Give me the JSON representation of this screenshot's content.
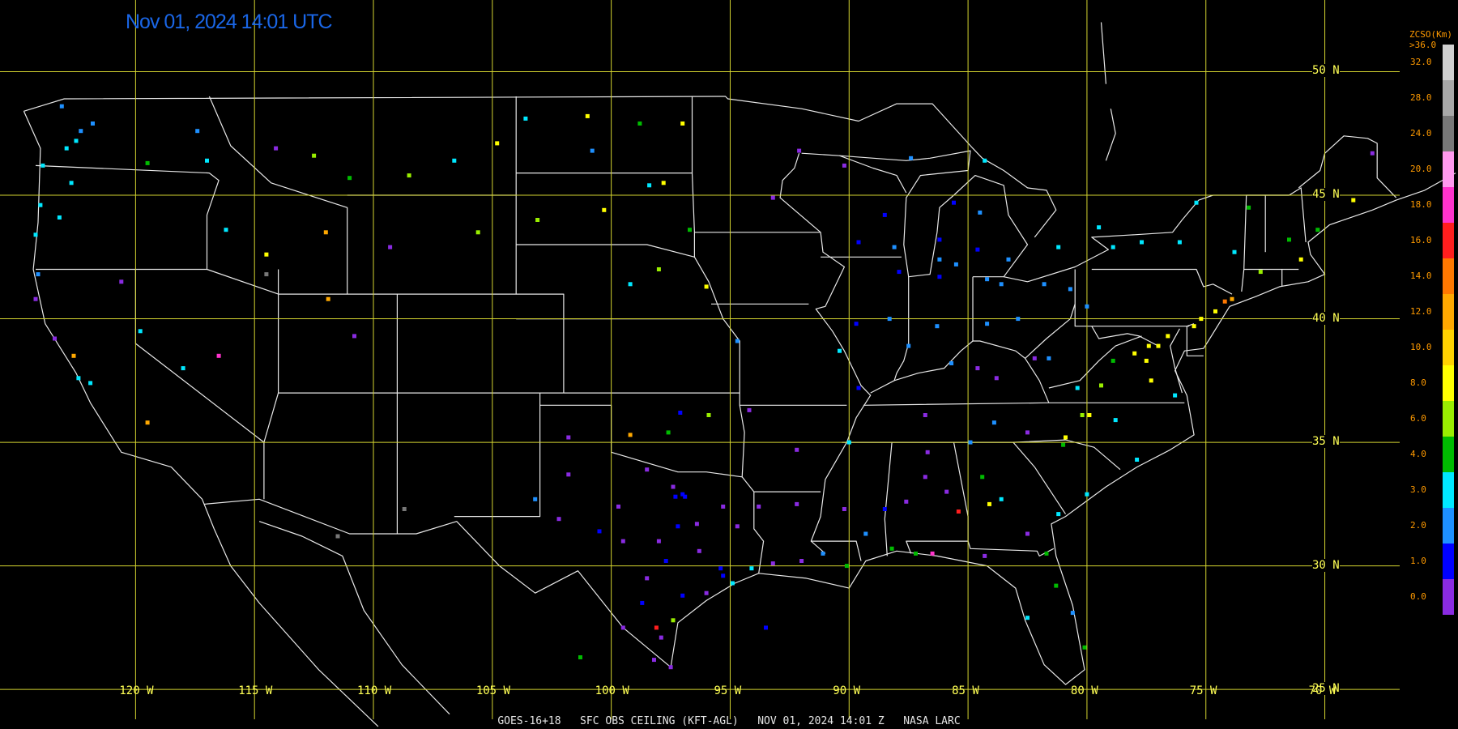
{
  "header": {
    "timestamp": "Nov 01, 2024 14:01 UTC",
    "timestamp_color": "#1a66e6"
  },
  "footer": {
    "caption": "GOES-16+18   SFC OBS CEILING (KFT-AGL)   NOV 01, 2024 14:01 Z   NASA LARC"
  },
  "grid": {
    "color": "#d4d430",
    "latitudes": [
      {
        "value": 50,
        "label": "50 N"
      },
      {
        "value": 45,
        "label": "45 N"
      },
      {
        "value": 40,
        "label": "40 N"
      },
      {
        "value": 35,
        "label": "35 N"
      },
      {
        "value": 30,
        "label": "30 N"
      },
      {
        "value": 25,
        "label": "25 N"
      }
    ],
    "longitudes": [
      {
        "value": -120,
        "label": "120 W"
      },
      {
        "value": -115,
        "label": "115 W"
      },
      {
        "value": -110,
        "label": "110 W"
      },
      {
        "value": -105,
        "label": "105 W"
      },
      {
        "value": -100,
        "label": "100 W"
      },
      {
        "value": -95,
        "label": "95 W"
      },
      {
        "value": -90,
        "label": "90 W"
      },
      {
        "value": -85,
        "label": "85 W"
      },
      {
        "value": -80,
        "label": "80 W"
      },
      {
        "value": -75,
        "label": "75 W"
      },
      {
        "value": -70,
        "label": "70 W"
      }
    ]
  },
  "map_extent": {
    "lon_min": -125.7,
    "lon_max": -64.4,
    "lat_min": 23.4,
    "lat_max": 52.9
  },
  "colors": {
    "background": "#000000",
    "boundaries": "#e8e8e8",
    "legend_text": "#ff9a00"
  },
  "legend": {
    "title": "ZCSO(Km)",
    "top_label": ">36.0",
    "classes": [
      {
        "label": "32.0",
        "color": "#d0d0d0"
      },
      {
        "label": "28.0",
        "color": "#a8a8a8"
      },
      {
        "label": "24.0",
        "color": "#787878"
      },
      {
        "label": "20.0",
        "color": "#ff99ee"
      },
      {
        "label": "18.0",
        "color": "#ff33cc"
      },
      {
        "label": "16.0",
        "color": "#ff1e1e"
      },
      {
        "label": "14.0",
        "color": "#ff7800"
      },
      {
        "label": "12.0",
        "color": "#ffa800"
      },
      {
        "label": "10.0",
        "color": "#ffd200"
      },
      {
        "label": "8.0",
        "color": "#ffff00"
      },
      {
        "label": "6.0",
        "color": "#99ee00"
      },
      {
        "label": "4.0",
        "color": "#00bb00"
      },
      {
        "label": "3.0",
        "color": "#00e8ff"
      },
      {
        "label": "2.0",
        "color": "#1e90ff"
      },
      {
        "label": "1.0",
        "color": "#0000ff"
      },
      {
        "label": "0.0",
        "color": "#8a2be2"
      }
    ]
  },
  "observations": [
    {
      "lon": -123.1,
      "lat": 48.6,
      "v": 2.5
    },
    {
      "lon": -122.3,
      "lat": 47.6,
      "v": 2.5
    },
    {
      "lon": -122.5,
      "lat": 47.2,
      "v": 3.5
    },
    {
      "lon": -121.8,
      "lat": 47.9,
      "v": 2.5
    },
    {
      "lon": -122.9,
      "lat": 46.9,
      "v": 3.5
    },
    {
      "lon": -123.9,
      "lat": 46.2,
      "v": 3.5
    },
    {
      "lon": -124.0,
      "lat": 44.6,
      "v": 3.5
    },
    {
      "lon": -123.2,
      "lat": 44.1,
      "v": 3.5
    },
    {
      "lon": -122.7,
      "lat": 45.5,
      "v": 3.5
    },
    {
      "lon": -124.2,
      "lat": 43.4,
      "v": 3.5
    },
    {
      "lon": -124.1,
      "lat": 41.8,
      "v": 2.5
    },
    {
      "lon": -124.2,
      "lat": 40.8,
      "v": 0.5
    },
    {
      "lon": -123.4,
      "lat": 39.2,
      "v": 0.5
    },
    {
      "lon": -122.4,
      "lat": 37.6,
      "v": 3.5
    },
    {
      "lon": -121.9,
      "lat": 37.4,
      "v": 3.5
    },
    {
      "lon": -122.6,
      "lat": 38.5,
      "v": 13
    },
    {
      "lon": -117.4,
      "lat": 47.6,
      "v": 2.5
    },
    {
      "lon": -119.5,
      "lat": 46.3,
      "v": 4.5
    },
    {
      "lon": -117.0,
      "lat": 46.4,
      "v": 3.5
    },
    {
      "lon": -116.2,
      "lat": 43.6,
      "v": 3.5
    },
    {
      "lon": -114.5,
      "lat": 42.6,
      "v": 9
    },
    {
      "lon": -112.0,
      "lat": 43.5,
      "v": 13
    },
    {
      "lon": -111.0,
      "lat": 45.7,
      "v": 5
    },
    {
      "lon": -112.5,
      "lat": 46.6,
      "v": 7
    },
    {
      "lon": -114.1,
      "lat": 46.9,
      "v": 0.5
    },
    {
      "lon": -108.5,
      "lat": 45.8,
      "v": 7
    },
    {
      "lon": -106.6,
      "lat": 46.4,
      "v": 3.5
    },
    {
      "lon": -104.8,
      "lat": 47.1,
      "v": 9
    },
    {
      "lon": -109.3,
      "lat": 42.9,
      "v": 0.5
    },
    {
      "lon": -105.6,
      "lat": 43.5,
      "v": 7
    },
    {
      "lon": -111.9,
      "lat": 40.8,
      "v": 13
    },
    {
      "lon": -110.8,
      "lat": 39.3,
      "v": 0.5
    },
    {
      "lon": -119.8,
      "lat": 39.5,
      "v": 3.5
    },
    {
      "lon": -120.6,
      "lat": 41.5,
      "v": 0.5
    },
    {
      "lon": -118.0,
      "lat": 38.0,
      "v": 3.5
    },
    {
      "lon": -119.5,
      "lat": 35.8,
      "v": 13
    },
    {
      "lon": -116.5,
      "lat": 38.5,
      "v": 19
    },
    {
      "lon": -101.0,
      "lat": 48.2,
      "v": 9
    },
    {
      "lon": -98.8,
      "lat": 47.9,
      "v": 5
    },
    {
      "lon": -97.0,
      "lat": 47.9,
      "v": 9
    },
    {
      "lon": -100.8,
      "lat": 46.8,
      "v": 2.5
    },
    {
      "lon": -103.6,
      "lat": 48.1,
      "v": 3.5
    },
    {
      "lon": -97.8,
      "lat": 45.5,
      "v": 9
    },
    {
      "lon": -96.7,
      "lat": 43.6,
      "v": 5
    },
    {
      "lon": -98.4,
      "lat": 45.4,
      "v": 3.5
    },
    {
      "lon": -100.3,
      "lat": 44.4,
      "v": 9
    },
    {
      "lon": -103.1,
      "lat": 44.0,
      "v": 7
    },
    {
      "lon": -96.0,
      "lat": 41.3,
      "v": 9
    },
    {
      "lon": -98.0,
      "lat": 42.0,
      "v": 7
    },
    {
      "lon": -99.2,
      "lat": 41.4,
      "v": 3.5
    },
    {
      "lon": -93.2,
      "lat": 44.9,
      "v": 0.5
    },
    {
      "lon": -92.1,
      "lat": 46.8,
      "v": 0.5
    },
    {
      "lon": -90.2,
      "lat": 46.2,
      "v": 0.5
    },
    {
      "lon": -89.6,
      "lat": 43.1,
      "v": 1.5
    },
    {
      "lon": -88.1,
      "lat": 42.9,
      "v": 2.5
    },
    {
      "lon": -86.2,
      "lat": 42.4,
      "v": 2.5
    },
    {
      "lon": -85.5,
      "lat": 42.2,
      "v": 2.5
    },
    {
      "lon": -84.6,
      "lat": 42.8,
      "v": 1.5
    },
    {
      "lon": -83.3,
      "lat": 42.4,
      "v": 2.5
    },
    {
      "lon": -84.5,
      "lat": 44.3,
      "v": 2.5
    },
    {
      "lon": -85.6,
      "lat": 44.7,
      "v": 1.5
    },
    {
      "lon": -86.2,
      "lat": 43.2,
      "v": 1.5
    },
    {
      "lon": -84.3,
      "lat": 46.4,
      "v": 3.5
    },
    {
      "lon": -87.4,
      "lat": 46.5,
      "v": 2.5
    },
    {
      "lon": -88.5,
      "lat": 44.2,
      "v": 1.5
    },
    {
      "lon": -87.9,
      "lat": 41.9,
      "v": 1.5
    },
    {
      "lon": -86.2,
      "lat": 41.7,
      "v": 1.5
    },
    {
      "lon": -84.2,
      "lat": 41.6,
      "v": 2.5
    },
    {
      "lon": -83.6,
      "lat": 41.4,
      "v": 2.5
    },
    {
      "lon": -81.8,
      "lat": 41.4,
      "v": 2.5
    },
    {
      "lon": -80.7,
      "lat": 41.2,
      "v": 2.5
    },
    {
      "lon": -82.9,
      "lat": 40.0,
      "v": 2.5
    },
    {
      "lon": -84.2,
      "lat": 39.8,
      "v": 2.5
    },
    {
      "lon": -86.3,
      "lat": 39.7,
      "v": 2.5
    },
    {
      "lon": -87.5,
      "lat": 38.9,
      "v": 2.5
    },
    {
      "lon": -88.3,
      "lat": 40.0,
      "v": 2.5
    },
    {
      "lon": -89.7,
      "lat": 39.8,
      "v": 1.5
    },
    {
      "lon": -90.4,
      "lat": 38.7,
      "v": 3.5
    },
    {
      "lon": -85.7,
      "lat": 38.2,
      "v": 2.5
    },
    {
      "lon": -84.6,
      "lat": 38.0,
      "v": 0.5
    },
    {
      "lon": -83.8,
      "lat": 37.6,
      "v": 0.5
    },
    {
      "lon": -82.2,
      "lat": 38.4,
      "v": 0.5
    },
    {
      "lon": -81.6,
      "lat": 38.4,
      "v": 2.5
    },
    {
      "lon": -80.0,
      "lat": 40.5,
      "v": 2.5
    },
    {
      "lon": -78.9,
      "lat": 42.9,
      "v": 3.5
    },
    {
      "lon": -77.7,
      "lat": 43.1,
      "v": 3.5
    },
    {
      "lon": -76.1,
      "lat": 43.1,
      "v": 3.5
    },
    {
      "lon": -73.8,
      "lat": 42.7,
      "v": 3.5
    },
    {
      "lon": -75.4,
      "lat": 44.7,
      "v": 3.5
    },
    {
      "lon": -79.5,
      "lat": 43.7,
      "v": 3.5
    },
    {
      "lon": -81.2,
      "lat": 42.9,
      "v": 3.5
    },
    {
      "lon": -73.2,
      "lat": 44.5,
      "v": 5
    },
    {
      "lon": -71.5,
      "lat": 43.2,
      "v": 5
    },
    {
      "lon": -70.3,
      "lat": 43.6,
      "v": 5
    },
    {
      "lon": -68.8,
      "lat": 44.8,
      "v": 9
    },
    {
      "lon": -68.0,
      "lat": 46.7,
      "v": 0.5
    },
    {
      "lon": -71.0,
      "lat": 42.4,
      "v": 9
    },
    {
      "lon": -72.7,
      "lat": 41.9,
      "v": 7
    },
    {
      "lon": -73.9,
      "lat": 40.8,
      "v": 13
    },
    {
      "lon": -74.2,
      "lat": 40.7,
      "v": 15
    },
    {
      "lon": -74.6,
      "lat": 40.3,
      "v": 9
    },
    {
      "lon": -75.2,
      "lat": 40.0,
      "v": 9
    },
    {
      "lon": -75.5,
      "lat": 39.7,
      "v": 9
    },
    {
      "lon": -76.6,
      "lat": 39.3,
      "v": 9
    },
    {
      "lon": -77.0,
      "lat": 38.9,
      "v": 9
    },
    {
      "lon": -77.4,
      "lat": 38.9,
      "v": 9
    },
    {
      "lon": -77.5,
      "lat": 38.3,
      "v": 9
    },
    {
      "lon": -77.3,
      "lat": 37.5,
      "v": 9
    },
    {
      "lon": -76.3,
      "lat": 36.9,
      "v": 3.5
    },
    {
      "lon": -78.0,
      "lat": 38.6,
      "v": 9
    },
    {
      "lon": -78.9,
      "lat": 38.3,
      "v": 5
    },
    {
      "lon": -79.4,
      "lat": 37.3,
      "v": 7
    },
    {
      "lon": -80.4,
      "lat": 37.2,
      "v": 3.5
    },
    {
      "lon": -80.2,
      "lat": 36.1,
      "v": 7
    },
    {
      "lon": -79.9,
      "lat": 36.1,
      "v": 9
    },
    {
      "lon": -78.8,
      "lat": 35.9,
      "v": 3.5
    },
    {
      "lon": -77.9,
      "lat": 34.3,
      "v": 3.5
    },
    {
      "lon": -80.9,
      "lat": 35.2,
      "v": 9
    },
    {
      "lon": -81.0,
      "lat": 34.9,
      "v": 5
    },
    {
      "lon": -82.5,
      "lat": 35.4,
      "v": 0.5
    },
    {
      "lon": -83.9,
      "lat": 35.8,
      "v": 2.5
    },
    {
      "lon": -84.9,
      "lat": 35.0,
      "v": 2.5
    },
    {
      "lon": -86.8,
      "lat": 36.1,
      "v": 0.5
    },
    {
      "lon": -86.7,
      "lat": 34.6,
      "v": 0.5
    },
    {
      "lon": -86.8,
      "lat": 33.6,
      "v": 0.5
    },
    {
      "lon": -85.9,
      "lat": 33.0,
      "v": 0.5
    },
    {
      "lon": -84.4,
      "lat": 33.6,
      "v": 5
    },
    {
      "lon": -84.1,
      "lat": 32.5,
      "v": 9
    },
    {
      "lon": -83.6,
      "lat": 32.7,
      "v": 3.5
    },
    {
      "lon": -81.2,
      "lat": 32.1,
      "v": 3.5
    },
    {
      "lon": -80.0,
      "lat": 32.9,
      "v": 3.5
    },
    {
      "lon": -82.5,
      "lat": 31.3,
      "v": 0.5
    },
    {
      "lon": -81.7,
      "lat": 30.5,
      "v": 5
    },
    {
      "lon": -81.3,
      "lat": 29.2,
      "v": 5
    },
    {
      "lon": -80.6,
      "lat": 28.1,
      "v": 2.5
    },
    {
      "lon": -80.1,
      "lat": 26.7,
      "v": 5
    },
    {
      "lon": -82.5,
      "lat": 27.9,
      "v": 3.5
    },
    {
      "lon": -84.3,
      "lat": 30.4,
      "v": 0.5
    },
    {
      "lon": -86.5,
      "lat": 30.5,
      "v": 19
    },
    {
      "lon": -87.2,
      "lat": 30.5,
      "v": 5
    },
    {
      "lon": -88.2,
      "lat": 30.7,
      "v": 5
    },
    {
      "lon": -85.4,
      "lat": 32.2,
      "v": 17
    },
    {
      "lon": -87.6,
      "lat": 32.6,
      "v": 0.5
    },
    {
      "lon": -88.5,
      "lat": 32.3,
      "v": 1.5
    },
    {
      "lon": -89.3,
      "lat": 31.3,
      "v": 2.5
    },
    {
      "lon": -90.2,
      "lat": 32.3,
      "v": 0.5
    },
    {
      "lon": -90.1,
      "lat": 30.0,
      "v": 5
    },
    {
      "lon": -91.1,
      "lat": 30.5,
      "v": 2.5
    },
    {
      "lon": -92.0,
      "lat": 30.2,
      "v": 0.5
    },
    {
      "lon": -93.2,
      "lat": 30.1,
      "v": 0.5
    },
    {
      "lon": -93.8,
      "lat": 32.4,
      "v": 0.5
    },
    {
      "lon": -92.2,
      "lat": 32.5,
      "v": 0.5
    },
    {
      "lon": -90.0,
      "lat": 35.0,
      "v": 3.5
    },
    {
      "lon": -89.6,
      "lat": 37.2,
      "v": 1.5
    },
    {
      "lon": -92.2,
      "lat": 34.7,
      "v": 0.5
    },
    {
      "lon": -94.2,
      "lat": 36.3,
      "v": 0.5
    },
    {
      "lon": -94.7,
      "lat": 39.1,
      "v": 2.5
    },
    {
      "lon": -97.6,
      "lat": 35.4,
      "v": 5
    },
    {
      "lon": -95.9,
      "lat": 36.1,
      "v": 7
    },
    {
      "lon": -97.1,
      "lat": 36.2,
      "v": 1.5
    },
    {
      "lon": -98.5,
      "lat": 33.9,
      "v": 0.5
    },
    {
      "lon": -99.2,
      "lat": 35.3,
      "v": 13
    },
    {
      "lon": -97.0,
      "lat": 32.9,
      "v": 1.5
    },
    {
      "lon": -96.9,
      "lat": 32.8,
      "v": 1.5
    },
    {
      "lon": -97.3,
      "lat": 32.8,
      "v": 1.5
    },
    {
      "lon": -97.4,
      "lat": 33.2,
      "v": 0.5
    },
    {
      "lon": -96.3,
      "lat": 30.6,
      "v": 0.5
    },
    {
      "lon": -97.7,
      "lat": 30.2,
      "v": 1.5
    },
    {
      "lon": -98.5,
      "lat": 29.5,
      "v": 0.5
    },
    {
      "lon": -95.3,
      "lat": 29.6,
      "v": 1.5
    },
    {
      "lon": -95.4,
      "lat": 29.9,
      "v": 1.5
    },
    {
      "lon": -94.1,
      "lat": 29.9,
      "v": 3.5
    },
    {
      "lon": -97.4,
      "lat": 27.8,
      "v": 7
    },
    {
      "lon": -97.5,
      "lat": 25.9,
      "v": 0.5
    },
    {
      "lon": -98.2,
      "lat": 26.2,
      "v": 0.5
    },
    {
      "lon": -99.5,
      "lat": 27.5,
      "v": 0.5
    },
    {
      "lon": -101.8,
      "lat": 35.2,
      "v": 0.5
    },
    {
      "lon": -101.8,
      "lat": 33.7,
      "v": 0.5
    },
    {
      "lon": -102.2,
      "lat": 31.9,
      "v": 0.5
    },
    {
      "lon": -103.2,
      "lat": 32.7,
      "v": 2.5
    },
    {
      "lon": -100.5,
      "lat": 31.4,
      "v": 1.5
    },
    {
      "lon": -99.7,
      "lat": 32.4,
      "v": 0.5
    },
    {
      "lon": -94.7,
      "lat": 31.6,
      "v": 0.5
    },
    {
      "lon": -95.3,
      "lat": 32.4,
      "v": 0.5
    },
    {
      "lon": -96.4,
      "lat": 31.7,
      "v": 0.5
    },
    {
      "lon": -97.2,
      "lat": 31.6,
      "v": 1.5
    },
    {
      "lon": -98.0,
      "lat": 31.0,
      "v": 0.5
    },
    {
      "lon": -99.5,
      "lat": 31.0,
      "v": 0.5
    },
    {
      "lon": -96.0,
      "lat": 28.9,
      "v": 0.5
    },
    {
      "lon": -97.0,
      "lat": 28.8,
      "v": 1.5
    },
    {
      "lon": -98.7,
      "lat": 28.5,
      "v": 1.5
    },
    {
      "lon": -97.9,
      "lat": 27.1,
      "v": 0.5
    },
    {
      "lon": -94.9,
      "lat": 29.3,
      "v": 3.5
    },
    {
      "lon": -93.5,
      "lat": 27.5,
      "v": 1.5
    },
    {
      "lon": -101.3,
      "lat": 26.3,
      "v": 5
    },
    {
      "lon": -98.1,
      "lat": 27.5,
      "v": 17
    },
    {
      "lon": -111.5,
      "lat": 31.2,
      "v": 27
    },
    {
      "lon": -108.7,
      "lat": 32.3,
      "v": 27
    },
    {
      "lon": -114.5,
      "lat": 41.8,
      "v": 27
    }
  ]
}
